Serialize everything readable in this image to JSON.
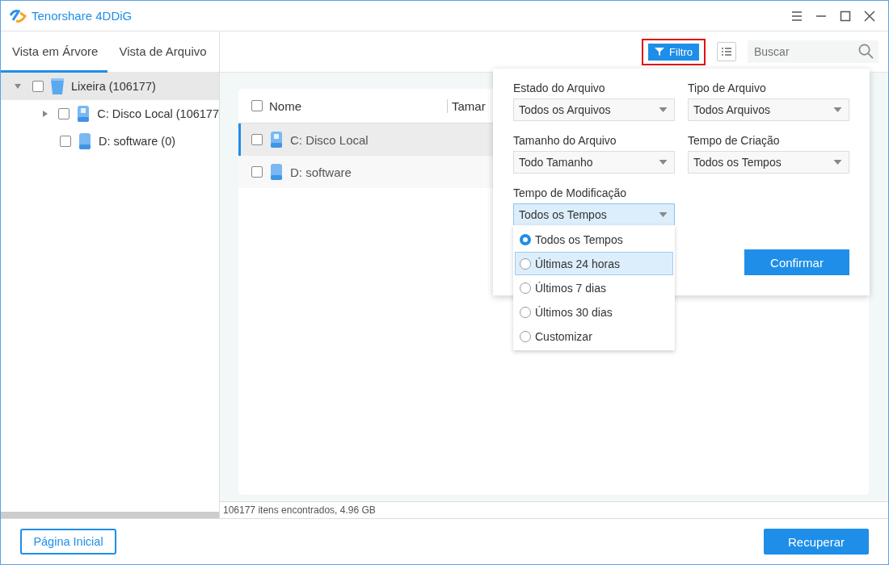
{
  "window": {
    "title": "Tenorshare 4DDiG"
  },
  "sidebar": {
    "tabs": [
      {
        "label": "Vista em Árvore",
        "selected": true
      },
      {
        "label": "Vista de Arquivo",
        "selected": false
      }
    ],
    "tree": [
      {
        "label": "Lixeira (106177)",
        "kind": "trash",
        "checked": false,
        "selected": true,
        "expanded": true,
        "children": [
          {
            "label": "C: Disco Local (106177",
            "kind": "windows-drive",
            "checked": false,
            "selected": false,
            "expanded": false
          },
          {
            "label": "D: software (0)",
            "kind": "drive",
            "checked": false,
            "selected": false
          }
        ]
      }
    ]
  },
  "toolbar": {
    "filter_button": {
      "label": "Filtro",
      "highlighted": true
    },
    "search": {
      "placeholder": "Buscar"
    }
  },
  "table": {
    "columns": [
      "Nome",
      "Tamar"
    ],
    "header_checked": false,
    "rows": [
      {
        "name": "C: Disco Local",
        "kind": "windows-drive",
        "checked": false,
        "selected": true
      },
      {
        "name": "D: software",
        "kind": "drive",
        "checked": false,
        "selected": false
      }
    ]
  },
  "filter_panel": {
    "fields": [
      {
        "label": "Estado do Arquivo",
        "value": "Todos os Arquivos",
        "open": false
      },
      {
        "label": "Tipo de Arquivo",
        "value": "Todos Arquivos",
        "open": false
      },
      {
        "label": "Tamanho do Arquivo",
        "value": "Todo Tamanho",
        "open": false
      },
      {
        "label": "Tempo de Criação",
        "value": "Todos os Tempos",
        "open": false
      },
      {
        "label": "Tempo de Modificação",
        "value": "Todos os Tempos",
        "open": true
      }
    ],
    "options": [
      {
        "label": "Todos os Tempos",
        "selected": true,
        "hovered": false
      },
      {
        "label": "Últimas 24 horas",
        "selected": false,
        "hovered": true
      },
      {
        "label": "Últimos 7 dias",
        "selected": false,
        "hovered": false
      },
      {
        "label": "Últimos 30 dias",
        "selected": false,
        "hovered": false
      },
      {
        "label": "Customizar",
        "selected": false,
        "hovered": false
      }
    ],
    "confirm": "Confirmar"
  },
  "status_bar": "106177 itens encontrados, 4.96 GB",
  "footer": {
    "home_button": "Página Inicial",
    "recover_button": "Recuperar"
  }
}
